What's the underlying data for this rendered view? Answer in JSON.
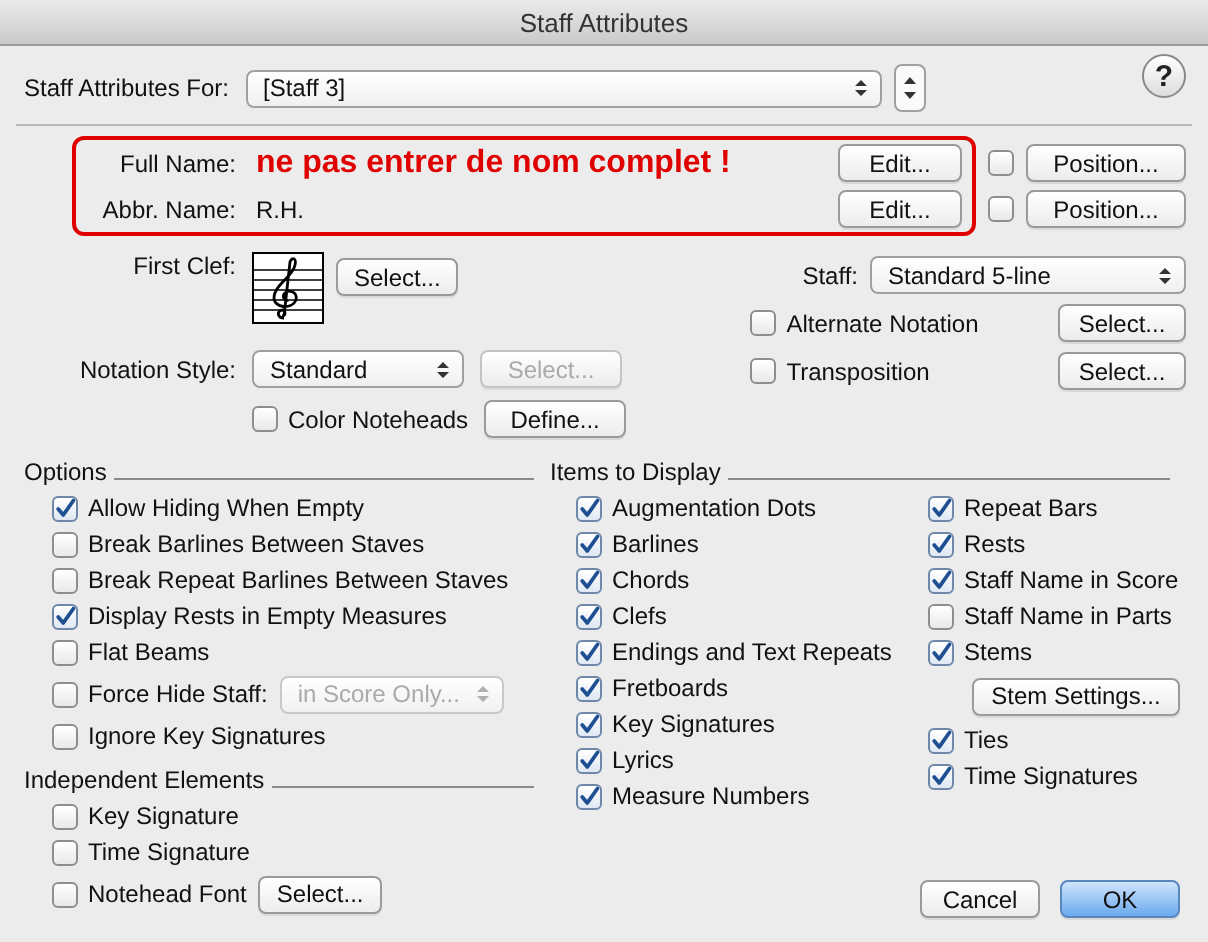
{
  "window": {
    "title": "Staff Attributes"
  },
  "help_button": {
    "label": "?"
  },
  "staff_for": {
    "label": "Staff Attributes For:",
    "value": "[Staff 3]"
  },
  "names": {
    "highlighted": true,
    "rows": [
      {
        "label": "Full Name:",
        "value": "ne pas entrer de nom complet !",
        "emphasis": true,
        "edit_button": "Edit...",
        "position_checked": false,
        "position_button": "Position..."
      },
      {
        "label": "Abbr. Name:",
        "value": "R.H.",
        "emphasis": false,
        "edit_button": "Edit...",
        "position_checked": false,
        "position_button": "Position..."
      }
    ]
  },
  "first_clef": {
    "label": "First Clef:",
    "button": "Select..."
  },
  "notation_style": {
    "label": "Notation Style:",
    "value": "Standard",
    "button": {
      "label": "Select...",
      "disabled": true
    }
  },
  "color_noteheads": {
    "label": "Color Noteheads",
    "checked": false,
    "button": "Define..."
  },
  "staff": {
    "label": "Staff:",
    "value": "Standard 5-line"
  },
  "alternate_notation": {
    "label": "Alternate Notation",
    "checked": false,
    "button": "Select..."
  },
  "transposition": {
    "label": "Transposition",
    "checked": false,
    "button": "Select..."
  },
  "options": {
    "title": "Options",
    "items": [
      {
        "kind": "checkbox",
        "label": "Allow Hiding When Empty",
        "checked": true
      },
      {
        "kind": "checkbox",
        "label": "Break Barlines Between Staves",
        "checked": false
      },
      {
        "kind": "checkbox",
        "label": "Break Repeat Barlines Between Staves",
        "checked": false
      },
      {
        "kind": "checkbox",
        "label": "Display Rests in Empty Measures",
        "checked": true
      },
      {
        "kind": "checkbox",
        "label": "Flat Beams",
        "checked": false
      },
      {
        "kind": "dropdown",
        "label": "Force Hide Staff:",
        "checked": false,
        "value": "in Score Only...",
        "disabled": true
      },
      {
        "kind": "checkbox",
        "label": "Ignore Key Signatures",
        "checked": false
      }
    ]
  },
  "independent": {
    "title": "Independent Elements",
    "items": [
      {
        "kind": "checkbox",
        "label": "Key Signature",
        "checked": false
      },
      {
        "kind": "checkbox",
        "label": "Time Signature",
        "checked": false
      },
      {
        "kind": "button",
        "label": "Notehead Font",
        "checked": false,
        "button": "Select..."
      }
    ]
  },
  "items_to_display": {
    "title": "Items to Display",
    "columns": [
      [
        {
          "kind": "checkbox",
          "label": "Augmentation Dots",
          "checked": true
        },
        {
          "kind": "checkbox",
          "label": "Barlines",
          "checked": true
        },
        {
          "kind": "checkbox",
          "label": "Chords",
          "checked": true
        },
        {
          "kind": "checkbox",
          "label": "Clefs",
          "checked": true
        },
        {
          "kind": "checkbox",
          "label": "Endings and Text Repeats",
          "checked": true
        },
        {
          "kind": "checkbox",
          "label": "Fretboards",
          "checked": true
        },
        {
          "kind": "checkbox",
          "label": "Key Signatures",
          "checked": true
        },
        {
          "kind": "checkbox",
          "label": "Lyrics",
          "checked": true
        },
        {
          "kind": "checkbox",
          "label": "Measure Numbers",
          "checked": true
        }
      ],
      [
        {
          "kind": "checkbox",
          "label": "Repeat Bars",
          "checked": true
        },
        {
          "kind": "checkbox",
          "label": "Rests",
          "checked": true
        },
        {
          "kind": "checkbox",
          "label": "Staff Name in Score",
          "checked": true
        },
        {
          "kind": "checkbox",
          "label": "Staff Name in Parts",
          "checked": false
        },
        {
          "kind": "checkbox",
          "label": "Stems",
          "checked": true
        },
        {
          "kind": "button",
          "label": "Stem Settings..."
        },
        {
          "kind": "checkbox",
          "label": "Ties",
          "checked": true
        },
        {
          "kind": "checkbox",
          "label": "Time Signatures",
          "checked": true
        }
      ]
    ]
  },
  "buttons": [
    {
      "label": "Cancel",
      "default": false
    },
    {
      "label": "OK",
      "default": true
    }
  ]
}
